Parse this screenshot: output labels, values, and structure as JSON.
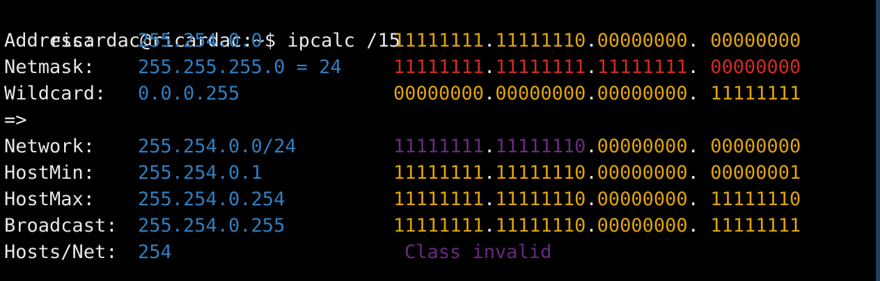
{
  "terminal": {
    "prompt": "ricardac@ricardac:~$ ",
    "command": "ipcalc /15",
    "rows": [
      {
        "label": "Address:",
        "value": "255.254.0.0",
        "binary": [
          "11111111",
          ".",
          "11111110",
          ".",
          "00000000",
          ". ",
          "00000000"
        ]
      },
      {
        "label": "Netmask:",
        "value": "255.255.255.0 = 24",
        "binary": [
          "11111111",
          ".",
          "11111111",
          ".",
          "11111111",
          ". ",
          "00000000"
        ]
      },
      {
        "label": "Wildcard:",
        "value": "0.0.0.255",
        "binary": [
          "00000000",
          ".",
          "00000000",
          ".",
          "00000000",
          ". ",
          "11111111"
        ]
      },
      {
        "label": "=>"
      },
      {
        "label": "Network:",
        "value": "255.254.0.0/24",
        "binary": [
          "11111111",
          ".",
          "11111110",
          ".",
          "00000000",
          ". ",
          "00000000"
        ]
      },
      {
        "label": "HostMin:",
        "value": "255.254.0.1",
        "binary": [
          "11111111",
          ".",
          "11111110",
          ".",
          "00000000",
          ". ",
          "00000001"
        ]
      },
      {
        "label": "HostMax:",
        "value": "255.254.0.254",
        "binary": [
          "11111111",
          ".",
          "11111110",
          ".",
          "00000000",
          ". ",
          "11111110"
        ]
      },
      {
        "label": "Broadcast:",
        "value": "255.254.0.255",
        "binary": [
          "11111111",
          ".",
          "11111110",
          ".",
          "00000000",
          ". ",
          "11111111"
        ]
      },
      {
        "label": "Hosts/Net:",
        "value": "254",
        "class_note": "Class invalid"
      }
    ]
  },
  "colors": {
    "background": "#000000",
    "text": "#e8e8e8",
    "value_blue": "#2f7fc1",
    "binary_yellow": "#e0a40a",
    "netmask_red": "#d02b1f",
    "network_purple": "#6a2a82"
  }
}
